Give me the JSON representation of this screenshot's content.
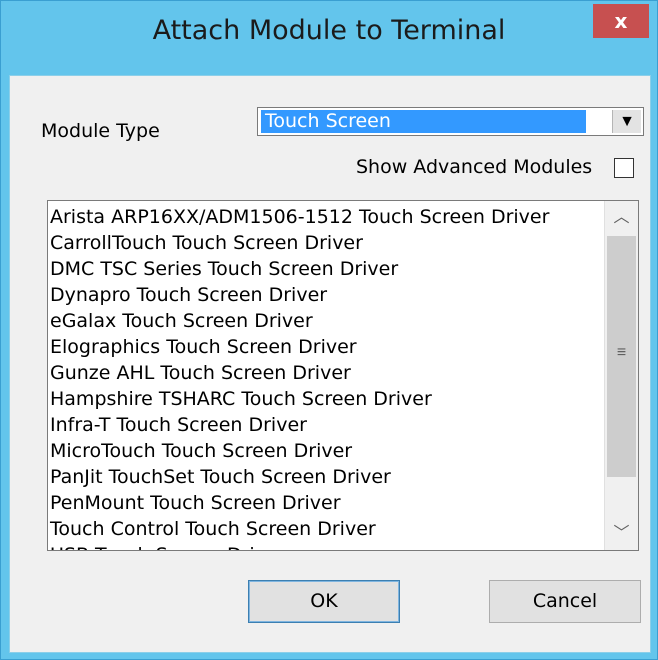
{
  "window": {
    "title": "Attach Module to Terminal",
    "close_label": "x"
  },
  "form": {
    "module_type_label": "Module Type",
    "module_type_value": "Touch Screen",
    "show_advanced_label": "Show Advanced Modules",
    "show_advanced_checked": false
  },
  "list": {
    "items": [
      "Arista ARP16XX/ADM1506-1512 Touch Screen Driver",
      "CarrollTouch Touch Screen Driver",
      "DMC TSC Series Touch Screen Driver",
      "Dynapro Touch Screen Driver",
      "eGalax Touch Screen Driver",
      "Elographics Touch Screen Driver",
      "Gunze AHL Touch Screen Driver",
      "Hampshire TSHARC Touch Screen Driver",
      "Infra-T Touch Screen Driver",
      "MicroTouch Touch Screen Driver",
      "PanJit TouchSet Touch Screen Driver",
      "PenMount Touch Screen Driver",
      "Touch Control Touch Screen Driver",
      "USB Touch Screen Driver"
    ]
  },
  "buttons": {
    "ok": "OK",
    "cancel": "Cancel"
  },
  "icons": {
    "close": "close-icon",
    "dropdown": "chevron-down-icon",
    "scroll_up": "chevron-up-icon",
    "scroll_down": "chevron-down-icon",
    "grip": "grip-icon"
  },
  "colors": {
    "titlebar": "#63c5ec",
    "close": "#c75050",
    "selection": "#3399ff",
    "client": "#f0f0f0"
  }
}
